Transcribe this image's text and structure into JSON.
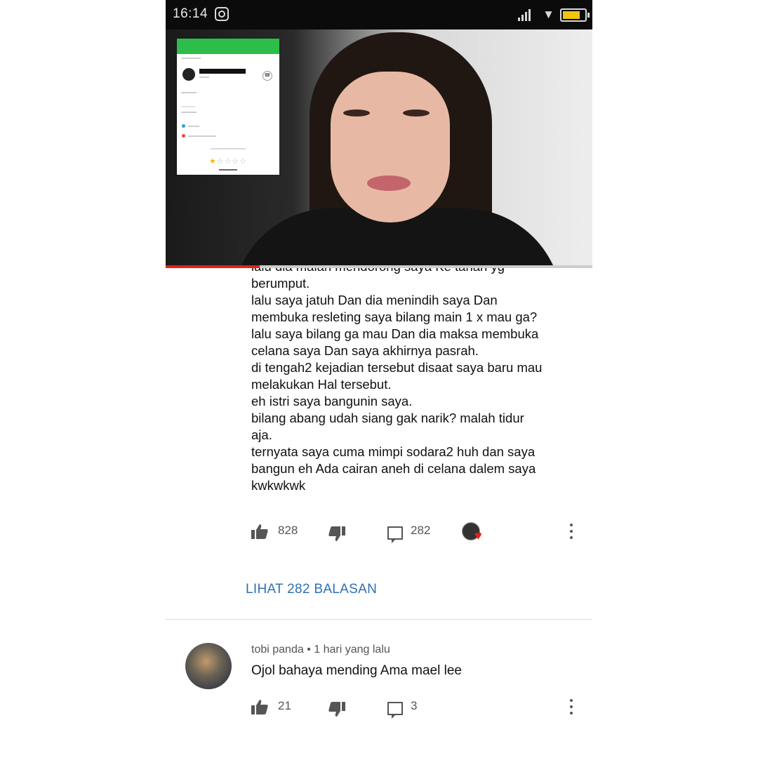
{
  "status_bar": {
    "time": "16:14"
  },
  "video": {
    "progress_fraction": 0.22
  },
  "comment": {
    "text": "lalu dia malah mendorong saya Ke tanah yg\nberumput.\nlalu saya jatuh Dan dia menindih saya Dan\nmembuka resleting saya bilang main 1 x mau ga?\nlalu saya bilang ga mau Dan dia maksa membuka\ncelana saya Dan saya akhirnya pasrah.\ndi tengah2 kejadian tersebut disaat saya baru mau\nmelakukan Hal tersebut.\neh istri saya bangunin saya.\nbilang abang udah siang gak narik? malah tidur\naja.\nternyata saya cuma mimpi sodara2 huh dan saya\nbangun eh Ada cairan aneh di celana dalem saya\nkwkwkwk",
    "likes": "828",
    "replies": "282",
    "view_replies_label": "LIHAT 282 BALASAN"
  },
  "reply_comment": {
    "author": "tobi panda",
    "separator": "•",
    "time": "1 hari yang lalu",
    "text": "Ojol bahaya mending Ama mael lee",
    "likes": "21",
    "replies": "3"
  },
  "colors": {
    "status_bar_bg": "#0b0b0b",
    "link_blue": "#2f6fb3",
    "progress_red": "#e62117",
    "app_green": "#2dbd4b",
    "icon_gray": "#555555"
  },
  "icons": [
    "instagram-icon",
    "signal-icon",
    "wifi-icon",
    "battery-icon",
    "like-icon",
    "dislike-icon",
    "reply-icon",
    "creator-heart-icon",
    "more-icon"
  ]
}
